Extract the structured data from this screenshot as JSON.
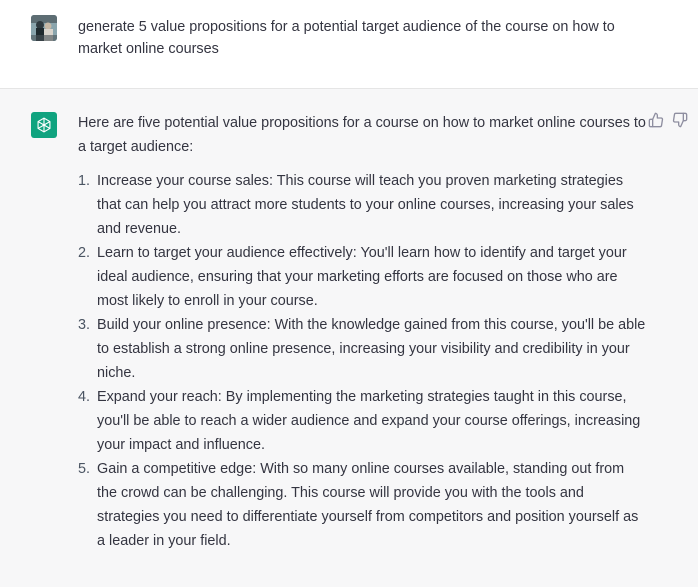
{
  "user_message": {
    "text": "generate 5 value propositions for a potential target audience of the course on how to market online courses"
  },
  "assistant_message": {
    "intro": "Here are five potential value propositions for a course on how to market online courses to a target audience:",
    "items": [
      {
        "num": "1.",
        "text": "Increase your course sales: This course will teach you proven marketing strategies that can help you attract more students to your online courses, increasing your sales and revenue."
      },
      {
        "num": "2.",
        "text": "Learn to target your audience effectively: You'll learn how to identify and target your ideal audience, ensuring that your marketing efforts are focused on those who are most likely to enroll in your course."
      },
      {
        "num": "3.",
        "text": "Build your online presence: With the knowledge gained from this course, you'll be able to establish a strong online presence, increasing your visibility and credibility in your niche."
      },
      {
        "num": "4.",
        "text": "Expand your reach: By implementing the marketing strategies taught in this course, you'll be able to reach a wider audience and expand your course offerings, increasing your impact and influence."
      },
      {
        "num": "5.",
        "text": "Gain a competitive edge: With so many online courses available, standing out from the crowd can be challenging. This course will provide you with the tools and strategies you need to differentiate yourself from competitors and position yourself as a leader in your field."
      }
    ]
  },
  "icons": {
    "user_avatar": "user-avatar",
    "assistant_logo": "openai-logo-icon",
    "thumbs_up": "thumbs-up-icon",
    "thumbs_down": "thumbs-down-icon"
  },
  "colors": {
    "assistant_bg": "#f7f7f8",
    "logo_bg": "#10a37f",
    "text": "#343541"
  }
}
